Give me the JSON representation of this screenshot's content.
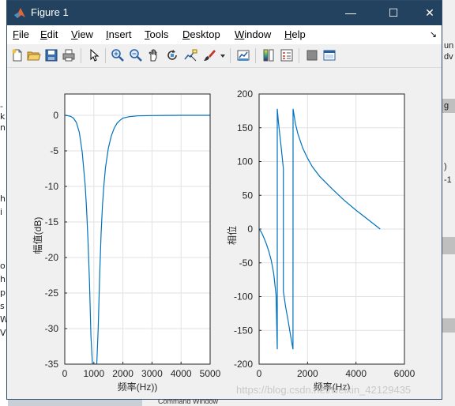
{
  "background": {
    "left_fragments": [
      "-k",
      "n",
      "h",
      "i",
      "o",
      "h",
      "p",
      "s",
      "W",
      "V",
      "S"
    ],
    "right_fragments": [
      "un",
      "dv",
      "g",
      ")",
      "-1"
    ],
    "bottom_fragment": "Command Window"
  },
  "window": {
    "title": "Figure 1",
    "controls": {
      "minimize": "—",
      "maximize": "☐",
      "close": "✕"
    }
  },
  "menu": {
    "items": [
      {
        "label": "File",
        "key": "F",
        "rest": "ile"
      },
      {
        "label": "Edit",
        "key": "E",
        "rest": "dit"
      },
      {
        "label": "View",
        "key": "V",
        "rest": "iew"
      },
      {
        "label": "Insert",
        "key": "I",
        "rest": "nsert"
      },
      {
        "label": "Tools",
        "key": "T",
        "rest": "ools"
      },
      {
        "label": "Desktop",
        "key": "D",
        "rest": "esktop"
      },
      {
        "label": "Window",
        "key": "W",
        "rest": "indow"
      },
      {
        "label": "Help",
        "key": "H",
        "rest": "elp"
      }
    ],
    "dock_arrow": "↘"
  },
  "toolbar": {
    "icons": [
      "new-figure-icon",
      "open-file-icon",
      "save-icon",
      "print-icon",
      "pointer-icon",
      "zoom-in-icon",
      "zoom-out-icon",
      "pan-icon",
      "rotate-icon",
      "data-cursor-icon",
      "brush-icon",
      "brush-dropdown-icon",
      "link-plot-icon",
      "colorbar-icon",
      "legend-icon",
      "hide-plot-tools-icon",
      "show-plot-tools-icon"
    ]
  },
  "colors": {
    "line": "#0072bd",
    "title_bar": "#23425f",
    "grid": "#e2e2e2"
  },
  "chart_data": [
    {
      "type": "line",
      "title": "",
      "xlabel": "频率(Hz))",
      "ylabel": "幅值(dB)",
      "xlim": [
        0,
        5000
      ],
      "ylim": [
        -35,
        3
      ],
      "xticks": [
        "0",
        "1000",
        "2000",
        "3000",
        "4000",
        "5000"
      ],
      "yticks": [
        "0",
        "-5",
        "-10",
        "-15",
        "-20",
        "-25",
        "-30",
        "-35"
      ],
      "grid": true,
      "series": [
        {
          "x": [
            0,
            100,
            200,
            300,
            400,
            500,
            600,
            700,
            750,
            800,
            850,
            900,
            950,
            1000,
            1050,
            1100,
            1150,
            1200,
            1250,
            1300,
            1350,
            1400,
            1500,
            1600,
            1700,
            1800,
            1900,
            2000,
            2200,
            2500,
            3000,
            3500,
            4000,
            4500,
            5000
          ],
          "y": [
            0,
            -0.05,
            -0.15,
            -0.4,
            -1.0,
            -2.4,
            -5.2,
            -9.8,
            -13.2,
            -17.6,
            -23.5,
            -31.0,
            -35,
            -35,
            -35,
            -35,
            -30.0,
            -22.4,
            -16.6,
            -12.5,
            -9.6,
            -7.4,
            -4.6,
            -2.9,
            -1.8,
            -1.1,
            -0.7,
            -0.4,
            -0.2,
            -0.08,
            -0.03,
            -0.01,
            0,
            0,
            0
          ]
        }
      ]
    },
    {
      "type": "line",
      "title": "",
      "xlabel": "频率(Hz)",
      "ylabel": "相位",
      "xlim": [
        0,
        6000
      ],
      "ylim": [
        -200,
        200
      ],
      "xticks": [
        "0",
        "2000",
        "4000",
        "6000"
      ],
      "yticks": [
        "200",
        "150",
        "100",
        "50",
        "0",
        "-50",
        "-100",
        "-150",
        "-200"
      ],
      "grid": true,
      "series": [
        {
          "x": [
            0,
            100,
            200,
            300,
            400,
            500,
            600,
            700,
            750,
            751,
            800,
            900,
            1000,
            1001,
            1100,
            1200,
            1300,
            1400,
            1401,
            1500,
            1600,
            1800,
            2000,
            2200,
            2500,
            3000,
            3500,
            4000,
            4500,
            5000
          ],
          "y": [
            0,
            -5,
            -13,
            -22,
            -33,
            -46,
            -65,
            -98,
            -178,
            178,
            158,
            125,
            90,
            -92,
            -116,
            -136,
            -158,
            -178,
            178,
            156,
            141,
            120,
            105,
            92,
            78,
            60,
            43,
            28,
            14,
            0
          ]
        }
      ]
    }
  ],
  "watermark": "https://blog.csdn.net/weixin_42129435"
}
